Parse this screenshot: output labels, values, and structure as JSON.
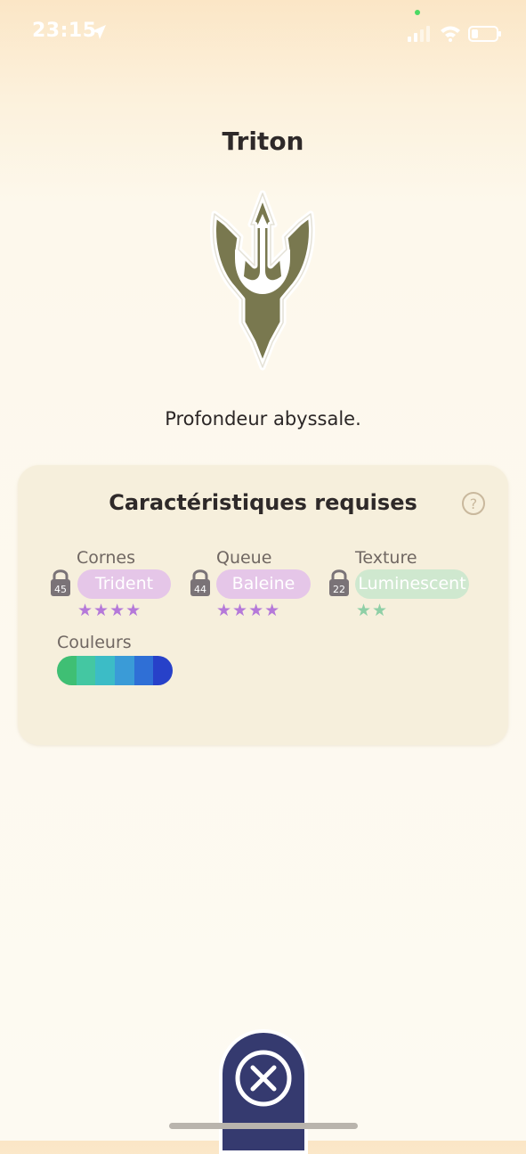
{
  "status_bar": {
    "time": "23:15",
    "icons": [
      "location-arrow-icon",
      "signal-icon",
      "wifi-icon",
      "battery-icon"
    ]
  },
  "page": {
    "title": "Triton",
    "emblem_icon": "trident-icon",
    "description": "Profondeur abyssale."
  },
  "requirements": {
    "title": "Caractéristiques requises",
    "help_icon": "question-mark-icon",
    "traits": [
      {
        "label": "Cornes",
        "lock_level": "45",
        "value": "Trident",
        "stars": "★★★★",
        "star_count": 4,
        "color": "#e5c6e8"
      },
      {
        "label": "Queue",
        "lock_level": "44",
        "value": "Baleine",
        "stars": "★★★★",
        "star_count": 4,
        "color": "#e5c6e8"
      },
      {
        "label": "Texture",
        "lock_level": "22",
        "value": "Luminescent",
        "stars": "★★",
        "star_count": 2,
        "color": "#cfe8cf"
      }
    ],
    "colors_label": "Couleurs",
    "colors": [
      "#3fbf74",
      "#44c7a2",
      "#3cbcc6",
      "#3a9bd7",
      "#2f6fd6",
      "#2741c9"
    ]
  },
  "footer": {
    "close_icon": "close-icon"
  }
}
